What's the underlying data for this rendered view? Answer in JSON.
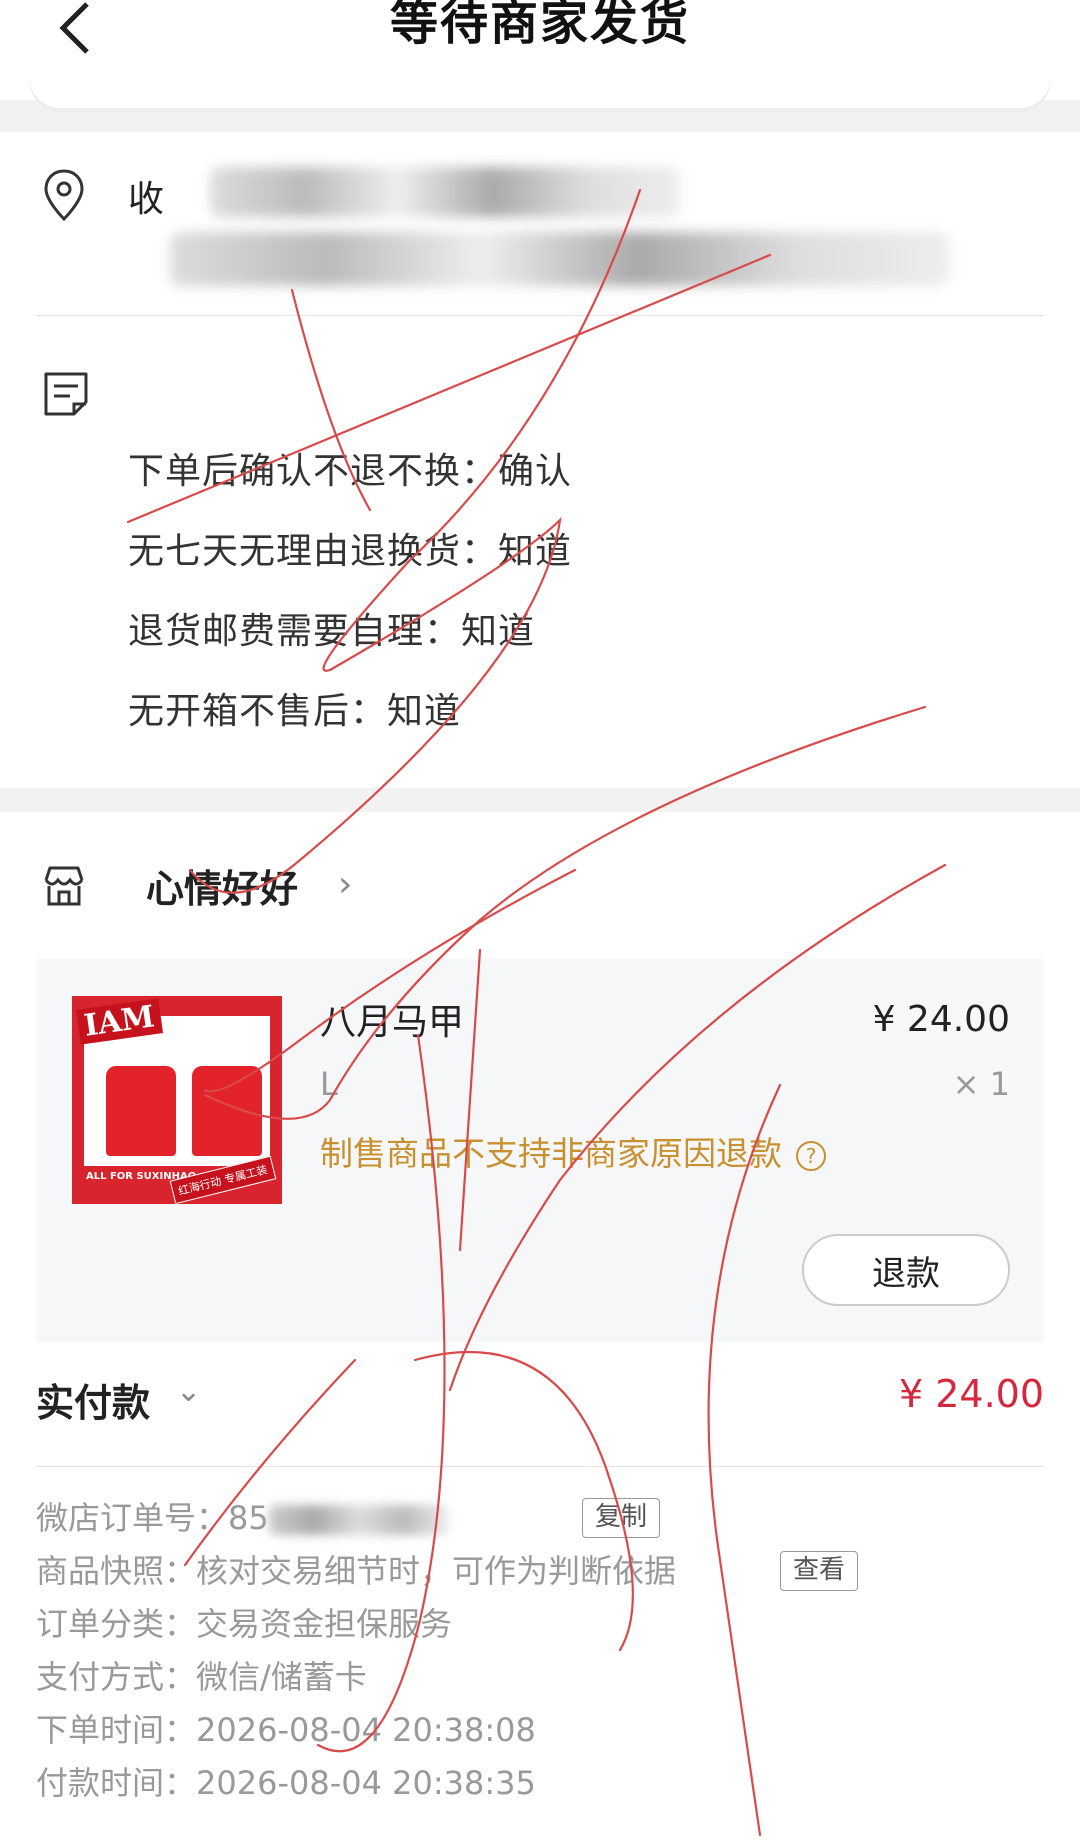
{
  "header": {
    "title": "等待商家发货",
    "back_icon": "chevron-left-icon"
  },
  "address": {
    "label": "收",
    "icon": "location-pin-icon"
  },
  "remarks": {
    "icon": "note-icon",
    "lines": [
      "下单后确认不退不换：确认",
      "无七天无理由退换货：知道",
      "退货邮费需要自理：知道",
      "无开箱不售后：知道"
    ]
  },
  "shop": {
    "icon": "store-icon",
    "name": "心情好好",
    "chevron": "›"
  },
  "item": {
    "name": "八月马甲",
    "spec": "L",
    "price": "¥ 24.00",
    "qty": "× 1",
    "warning": "制售商品不支持非商家原因退款",
    "help": "?",
    "refund_label": "退款",
    "thumb": {
      "logo": "IAM",
      "footer": "ALL FOR SUXINHAO",
      "tag": "红海行动 专属工装"
    }
  },
  "payment": {
    "label": "实付款",
    "chevron": "⌄",
    "amount": "¥ 24.00"
  },
  "info": {
    "order_no_label": "微店订单号：",
    "order_no_value": "85",
    "copy_label": "复制",
    "snapshot_label": "商品快照：",
    "snapshot_value": "核对交易细节时，可作为判断依据",
    "view_label": "查看",
    "category_label": "订单分类：",
    "category_value": "交易资金担保服务",
    "pay_method_label": "支付方式：",
    "pay_method_value": "微信/储蓄卡",
    "order_time_label": "下单时间：",
    "order_time_value": "2026-08-04 20:38:08",
    "pay_time_label": "付款时间：",
    "pay_time_value": "2026-08-04 20:38:35"
  },
  "colors": {
    "accent_red": "#d7263d",
    "warning_orange": "#c8902e",
    "scribble": "#d94a4a"
  }
}
